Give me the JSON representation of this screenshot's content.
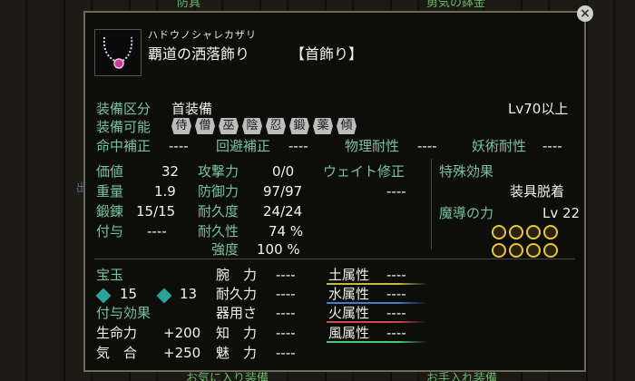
{
  "background": {
    "top_left_text": "防具",
    "top_right_text": "勇気の鉢金",
    "bottom_left_text": "お気に入り装備",
    "bottom_right_text": "お手入れ装備",
    "side_text": "出"
  },
  "item": {
    "icon": "necklace-icon",
    "furigana": "ハドウノシャレカザリ",
    "name": "覇道の洒落飾り",
    "type": "【首飾り】"
  },
  "equip_category": {
    "label": "装備区分",
    "value": "首装備",
    "level_req": "Lv70以上"
  },
  "equip_jobs": {
    "label": "装備可能",
    "jobs": [
      "侍",
      "僧",
      "巫",
      "陰",
      "忍",
      "鍛",
      "薬",
      "傾"
    ]
  },
  "corrections": [
    {
      "label": "命中補正",
      "value": "----"
    },
    {
      "label": "回避補正",
      "value": "----"
    },
    {
      "label": "物理耐性",
      "value": "----"
    },
    {
      "label": "妖術耐性",
      "value": "----"
    }
  ],
  "stats_left": [
    {
      "label": "価値",
      "value": "32"
    },
    {
      "label": "重量",
      "value": "1.9"
    },
    {
      "label": "鍛錬",
      "value": "15/15"
    },
    {
      "label": "付与",
      "value": "----"
    }
  ],
  "stats_mid": [
    {
      "label": "攻撃力",
      "value": "0/0"
    },
    {
      "label": "防御力",
      "value": "97/97"
    },
    {
      "label": "耐久度",
      "value": "24/24"
    },
    {
      "label": "耐久性",
      "value": "74 %"
    },
    {
      "label": "強度",
      "value": "100 %"
    }
  ],
  "weight_correction": {
    "label": "ウェイト修正",
    "value": "----"
  },
  "special": {
    "label": "特殊効果",
    "value": "装具脱着",
    "magic_label": "魔導の力",
    "magic_level": "Lv 22",
    "coin_count": 8
  },
  "gems": {
    "label": "宝玉",
    "count_a": "15",
    "count_b": "13"
  },
  "enchant": {
    "label": "付与効果",
    "effects": [
      {
        "label": "生命力",
        "value": "+200"
      },
      {
        "label": "気　合",
        "value": "+250"
      }
    ]
  },
  "attributes_mid": [
    {
      "label": "腕　力",
      "value": "----"
    },
    {
      "label": "耐久力",
      "value": "----"
    },
    {
      "label": "器用さ",
      "value": "----"
    },
    {
      "label": "知　力",
      "value": "----"
    },
    {
      "label": "魅　力",
      "value": "----"
    }
  ],
  "elements": [
    {
      "label": "土属性",
      "value": "----",
      "color": "#c8b84a"
    },
    {
      "label": "水属性",
      "value": "----",
      "color": "#4a7ac8"
    },
    {
      "label": "火属性",
      "value": "----",
      "color": "#c84a4a"
    },
    {
      "label": "風属性",
      "value": "----",
      "color": "#4ac87a"
    }
  ],
  "close": "×"
}
